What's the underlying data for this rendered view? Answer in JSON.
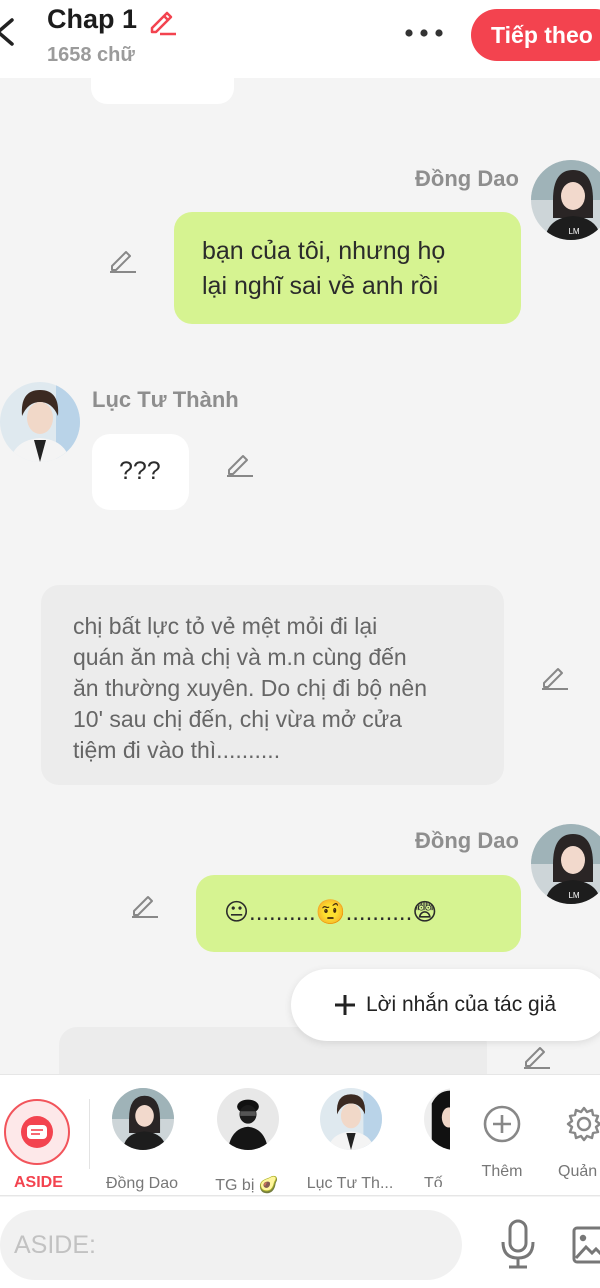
{
  "header": {
    "title": "Chap 1",
    "word_count": "1658 chữ",
    "next_label": "Tiếp theo"
  },
  "messages": [
    {
      "speaker": "Đồng Dao",
      "text_lines": [
        "bạn của tôi, nhưng họ",
        "lại nghĩ sai về anh rồi"
      ]
    },
    {
      "speaker": "Lục Tư Thành",
      "text": "???"
    },
    {
      "speaker": "",
      "text_lines": [
        "chị bất lực tỏ vẻ mệt mỏi đi lại",
        "quán ăn mà chị và m.n cùng đến",
        "ăn thường xuyên. Do chị đi bộ nên",
        "10' sau chị đến, chị vừa mở cửa",
        "tiệm đi vào thì.........."
      ]
    },
    {
      "speaker": "Đồng Dao",
      "text": "😐..........🤨..........😨"
    }
  ],
  "author_note_label": "Lời nhắn của tác giả",
  "characters": [
    {
      "label": "ASIDE"
    },
    {
      "label": "Đồng Dao"
    },
    {
      "label": "TG bị 🥑"
    },
    {
      "label": "Lục Tư Th..."
    },
    {
      "label": "Tố"
    },
    {
      "label": "Thêm"
    },
    {
      "label": "Quản"
    }
  ],
  "input": {
    "placeholder": "ASIDE:",
    "value": ""
  },
  "colors": {
    "accent": "#f3434f",
    "bubble_green": "#d6f391",
    "bubble_grey": "#ececec"
  },
  "icons": [
    "back-icon",
    "edit-icon",
    "more-icon",
    "pencil-icon",
    "plus-icon",
    "add-circle-icon",
    "gear-icon",
    "microphone-icon",
    "image-icon"
  ]
}
